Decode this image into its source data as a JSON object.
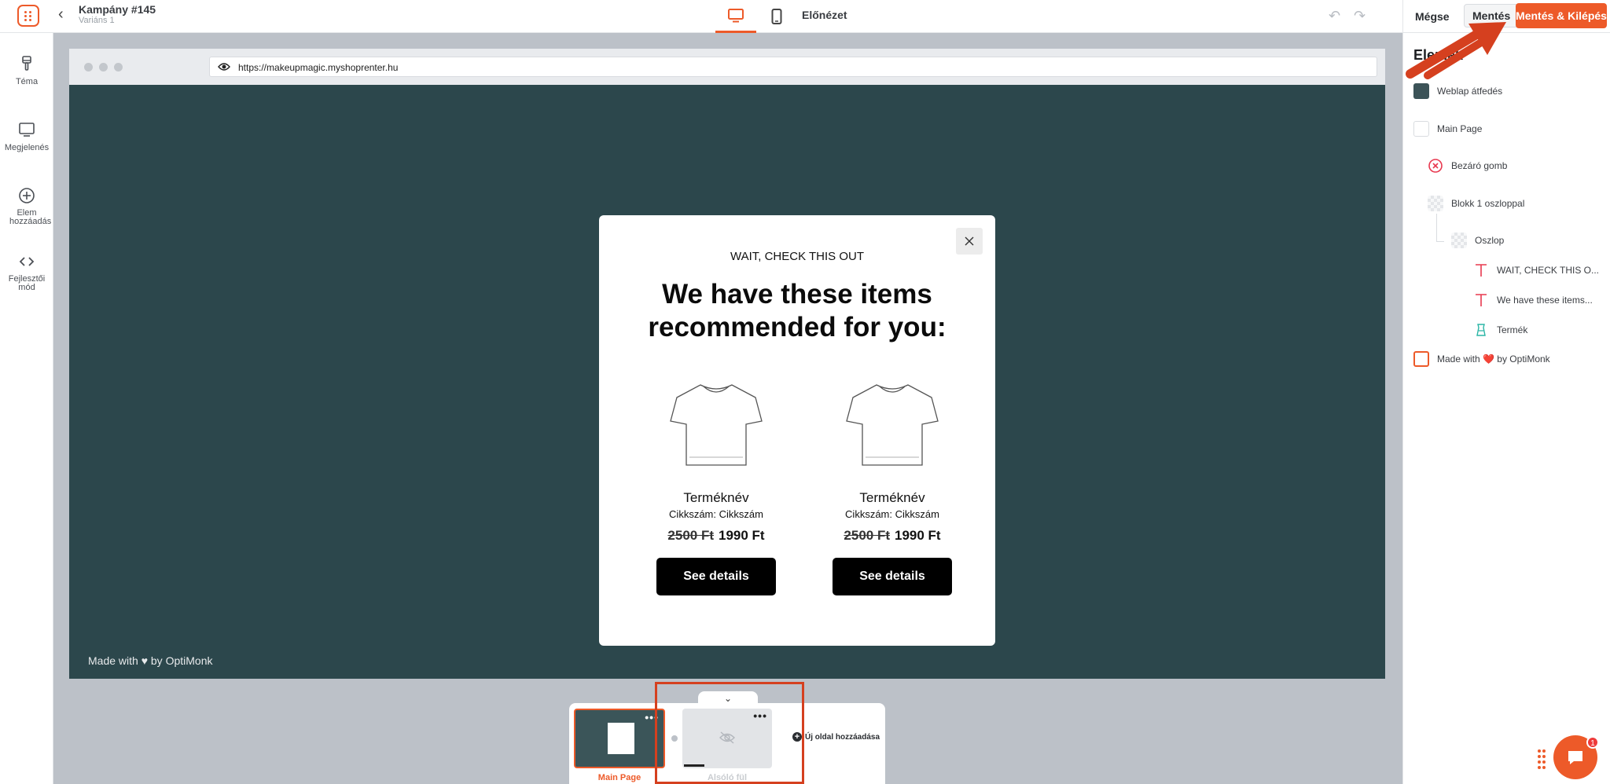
{
  "header": {
    "campaign_title": "Kampány #145",
    "variant_name": "Variáns 1",
    "preview_label": "Előnézet",
    "cancel_label": "Mégse",
    "save_label": "Mentés",
    "save_exit_label": "Mentés & Kilépés"
  },
  "left_rail": {
    "items": [
      {
        "label": "Téma",
        "icon": "brush-icon"
      },
      {
        "label": "Megjelenés",
        "icon": "monitor-icon"
      },
      {
        "label": "Elem hozzáadás",
        "icon": "add-circle-icon"
      },
      {
        "label": "Fejlesztői mód",
        "icon": "code-icon"
      }
    ]
  },
  "browser": {
    "url": "https://makeupmagic.myshoprenter.hu"
  },
  "popup": {
    "subheadline": "WAIT, CHECK THIS OUT",
    "headline": "We have these items recommended for you:",
    "products": [
      {
        "name": "Terméknév",
        "sku": "Cikkszám: Cikkszám",
        "old_price": "2500 Ft",
        "price": "1990 Ft",
        "button": "See details"
      },
      {
        "name": "Terméknév",
        "sku": "Cikkszám: Cikkszám",
        "old_price": "2500 Ft",
        "price": "1990 Ft",
        "button": "See details"
      }
    ]
  },
  "canvas_footer": "Made with ♥ by OptiMonk",
  "pages": {
    "main_label": "Main Page",
    "side_label": "Alsóló fül",
    "add_label": "Új oldal hozzáadása"
  },
  "right_panel": {
    "title": "Elemek",
    "items": [
      {
        "label": "Weblap átfedés",
        "swatch": "#3c5358"
      },
      {
        "label": "Main Page",
        "swatch": "#ffffff"
      },
      {
        "label": "Bezáró gomb",
        "icon": "close-circle-icon"
      },
      {
        "label": "Blokk 1 oszloppal",
        "icon": "checker"
      },
      {
        "label": "Oszlop",
        "icon": "checker"
      },
      {
        "label": "WAIT, CHECK THIS O...",
        "icon": "text-icon"
      },
      {
        "label": "We have these items...",
        "icon": "text-icon"
      },
      {
        "label": "Termék",
        "icon": "product-icon"
      },
      {
        "label": "Made with ❤️ by OptiMonk",
        "icon": "optimonk-icon"
      }
    ]
  },
  "chat": {
    "badge": "1"
  },
  "colors": {
    "accent": "#ed5a29",
    "overlay": "#2c474c"
  }
}
